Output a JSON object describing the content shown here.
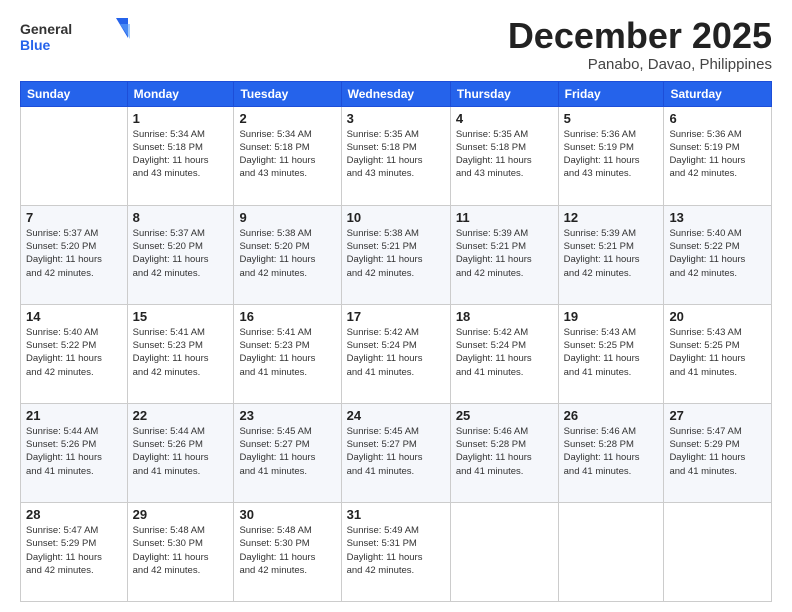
{
  "header": {
    "logo_general": "General",
    "logo_blue": "Blue",
    "month": "December 2025",
    "location": "Panabo, Davao, Philippines"
  },
  "days_of_week": [
    "Sunday",
    "Monday",
    "Tuesday",
    "Wednesday",
    "Thursday",
    "Friday",
    "Saturday"
  ],
  "weeks": [
    [
      {
        "day": "",
        "info": ""
      },
      {
        "day": "1",
        "info": "Sunrise: 5:34 AM\nSunset: 5:18 PM\nDaylight: 11 hours\nand 43 minutes."
      },
      {
        "day": "2",
        "info": "Sunrise: 5:34 AM\nSunset: 5:18 PM\nDaylight: 11 hours\nand 43 minutes."
      },
      {
        "day": "3",
        "info": "Sunrise: 5:35 AM\nSunset: 5:18 PM\nDaylight: 11 hours\nand 43 minutes."
      },
      {
        "day": "4",
        "info": "Sunrise: 5:35 AM\nSunset: 5:18 PM\nDaylight: 11 hours\nand 43 minutes."
      },
      {
        "day": "5",
        "info": "Sunrise: 5:36 AM\nSunset: 5:19 PM\nDaylight: 11 hours\nand 43 minutes."
      },
      {
        "day": "6",
        "info": "Sunrise: 5:36 AM\nSunset: 5:19 PM\nDaylight: 11 hours\nand 42 minutes."
      }
    ],
    [
      {
        "day": "7",
        "info": "Sunrise: 5:37 AM\nSunset: 5:20 PM\nDaylight: 11 hours\nand 42 minutes."
      },
      {
        "day": "8",
        "info": "Sunrise: 5:37 AM\nSunset: 5:20 PM\nDaylight: 11 hours\nand 42 minutes."
      },
      {
        "day": "9",
        "info": "Sunrise: 5:38 AM\nSunset: 5:20 PM\nDaylight: 11 hours\nand 42 minutes."
      },
      {
        "day": "10",
        "info": "Sunrise: 5:38 AM\nSunset: 5:21 PM\nDaylight: 11 hours\nand 42 minutes."
      },
      {
        "day": "11",
        "info": "Sunrise: 5:39 AM\nSunset: 5:21 PM\nDaylight: 11 hours\nand 42 minutes."
      },
      {
        "day": "12",
        "info": "Sunrise: 5:39 AM\nSunset: 5:21 PM\nDaylight: 11 hours\nand 42 minutes."
      },
      {
        "day": "13",
        "info": "Sunrise: 5:40 AM\nSunset: 5:22 PM\nDaylight: 11 hours\nand 42 minutes."
      }
    ],
    [
      {
        "day": "14",
        "info": "Sunrise: 5:40 AM\nSunset: 5:22 PM\nDaylight: 11 hours\nand 42 minutes."
      },
      {
        "day": "15",
        "info": "Sunrise: 5:41 AM\nSunset: 5:23 PM\nDaylight: 11 hours\nand 42 minutes."
      },
      {
        "day": "16",
        "info": "Sunrise: 5:41 AM\nSunset: 5:23 PM\nDaylight: 11 hours\nand 41 minutes."
      },
      {
        "day": "17",
        "info": "Sunrise: 5:42 AM\nSunset: 5:24 PM\nDaylight: 11 hours\nand 41 minutes."
      },
      {
        "day": "18",
        "info": "Sunrise: 5:42 AM\nSunset: 5:24 PM\nDaylight: 11 hours\nand 41 minutes."
      },
      {
        "day": "19",
        "info": "Sunrise: 5:43 AM\nSunset: 5:25 PM\nDaylight: 11 hours\nand 41 minutes."
      },
      {
        "day": "20",
        "info": "Sunrise: 5:43 AM\nSunset: 5:25 PM\nDaylight: 11 hours\nand 41 minutes."
      }
    ],
    [
      {
        "day": "21",
        "info": "Sunrise: 5:44 AM\nSunset: 5:26 PM\nDaylight: 11 hours\nand 41 minutes."
      },
      {
        "day": "22",
        "info": "Sunrise: 5:44 AM\nSunset: 5:26 PM\nDaylight: 11 hours\nand 41 minutes."
      },
      {
        "day": "23",
        "info": "Sunrise: 5:45 AM\nSunset: 5:27 PM\nDaylight: 11 hours\nand 41 minutes."
      },
      {
        "day": "24",
        "info": "Sunrise: 5:45 AM\nSunset: 5:27 PM\nDaylight: 11 hours\nand 41 minutes."
      },
      {
        "day": "25",
        "info": "Sunrise: 5:46 AM\nSunset: 5:28 PM\nDaylight: 11 hours\nand 41 minutes."
      },
      {
        "day": "26",
        "info": "Sunrise: 5:46 AM\nSunset: 5:28 PM\nDaylight: 11 hours\nand 41 minutes."
      },
      {
        "day": "27",
        "info": "Sunrise: 5:47 AM\nSunset: 5:29 PM\nDaylight: 11 hours\nand 41 minutes."
      }
    ],
    [
      {
        "day": "28",
        "info": "Sunrise: 5:47 AM\nSunset: 5:29 PM\nDaylight: 11 hours\nand 42 minutes."
      },
      {
        "day": "29",
        "info": "Sunrise: 5:48 AM\nSunset: 5:30 PM\nDaylight: 11 hours\nand 42 minutes."
      },
      {
        "day": "30",
        "info": "Sunrise: 5:48 AM\nSunset: 5:30 PM\nDaylight: 11 hours\nand 42 minutes."
      },
      {
        "day": "31",
        "info": "Sunrise: 5:49 AM\nSunset: 5:31 PM\nDaylight: 11 hours\nand 42 minutes."
      },
      {
        "day": "",
        "info": ""
      },
      {
        "day": "",
        "info": ""
      },
      {
        "day": "",
        "info": ""
      }
    ]
  ]
}
